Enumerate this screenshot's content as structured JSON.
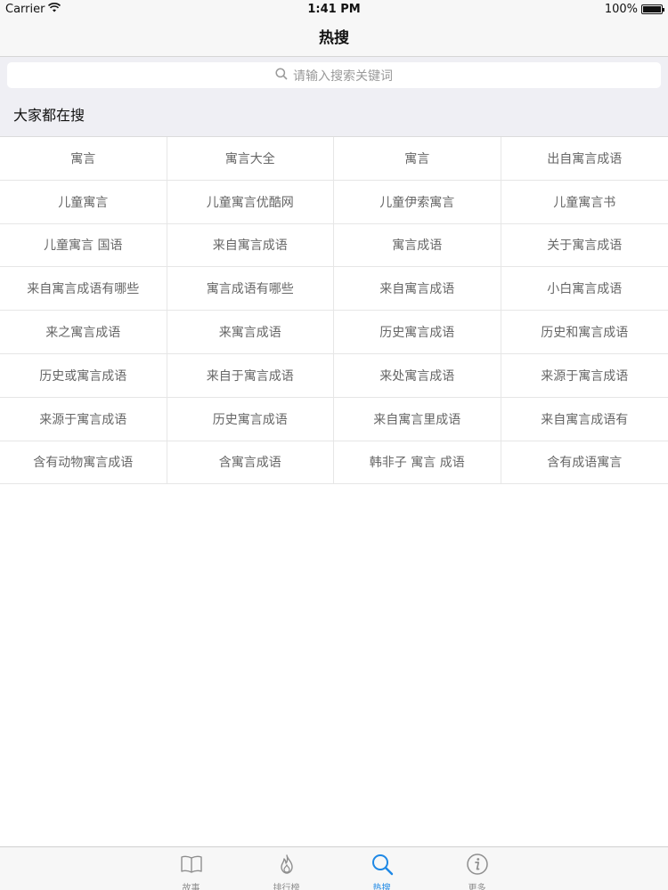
{
  "status_bar": {
    "carrier": "Carrier",
    "time": "1:41 PM",
    "battery": "100%"
  },
  "nav": {
    "title": "热搜"
  },
  "search": {
    "placeholder": "请输入搜索关键词"
  },
  "section": {
    "title": "大家都在搜"
  },
  "hot_terms": [
    "寓言",
    "寓言大全",
    "寓言",
    "出自寓言成语",
    "儿童寓言",
    "儿童寓言优酷网",
    "儿童伊索寓言",
    "儿童寓言书",
    "儿童寓言 国语",
    "来自寓言成语",
    "寓言成语",
    "关于寓言成语",
    "来自寓言成语有哪些",
    "寓言成语有哪些",
    "来自寓言成语",
    "小白寓言成语",
    "来之寓言成语",
    "来寓言成语",
    "历史寓言成语",
    "历史和寓言成语",
    "历史或寓言成语",
    "来自于寓言成语",
    "来处寓言成语",
    "来源于寓言成语",
    "来源于寓言成语",
    "历史寓言成语",
    "来自寓言里成语",
    "来自寓言成语有",
    "含有动物寓言成语",
    "含寓言成语",
    "韩非子 寓言 成语",
    "含有成语寓言"
  ],
  "tabs": [
    {
      "label": "故事",
      "icon": "book-icon",
      "active": false
    },
    {
      "label": "排行榜",
      "icon": "flame-icon",
      "active": false
    },
    {
      "label": "热搜",
      "icon": "search-icon",
      "active": true
    },
    {
      "label": "更多",
      "icon": "info-icon",
      "active": false
    }
  ],
  "colors": {
    "accent": "#1e88e5",
    "tab_inactive": "#8e8e8e",
    "cell_text": "#666666"
  }
}
